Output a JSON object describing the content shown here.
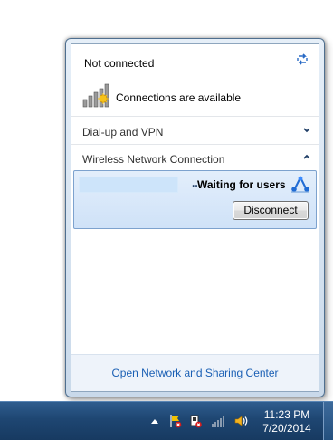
{
  "flyout": {
    "status_title": "Not connected",
    "availability_text": "Connections are available",
    "sections": [
      {
        "label": "Dial-up and VPN",
        "expanded": false
      },
      {
        "label": "Wireless Network Connection",
        "expanded": true
      }
    ],
    "connection": {
      "ssid": "",
      "ellipsis": "...",
      "status": "Waiting for users",
      "button_label_underlined": "D",
      "button_label_rest": "isconnect"
    },
    "footer_link": "Open Network and Sharing Center"
  },
  "taskbar": {
    "time": "11:23 PM",
    "date": "7/20/2014",
    "tray_icons": [
      "action-center-flag-icon",
      "removable-device-icon",
      "network-signal-icon",
      "volume-icon"
    ]
  },
  "colors": {
    "link": "#1a5fb4",
    "taskbar": "#1e4672",
    "selection": "#cfe2f8"
  }
}
